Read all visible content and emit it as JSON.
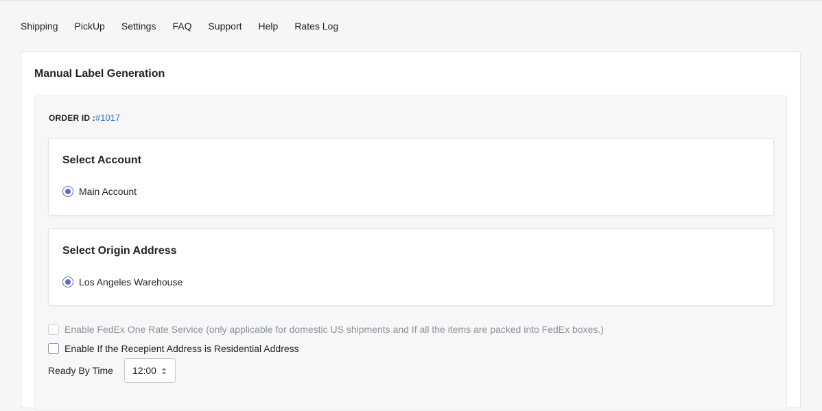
{
  "nav": {
    "items": [
      "Shipping",
      "PickUp",
      "Settings",
      "FAQ",
      "Support",
      "Help",
      "Rates Log"
    ]
  },
  "card": {
    "title": "Manual Label Generation",
    "order_label": "ORDER ID :",
    "order_value": "#1017"
  },
  "select_account": {
    "title": "Select Account",
    "option": "Main Account",
    "selected": true
  },
  "select_origin": {
    "title": "Select Origin Address",
    "option": "Los Angeles Warehouse",
    "selected": true
  },
  "options": {
    "one_rate_label": "Enable FedEx One Rate Service (only applicable for domestic US shipments and If all the items are packed into FedEx boxes.)",
    "one_rate_checked": false,
    "one_rate_disabled": true,
    "residential_label": "Enable If the Recepient Address is Residential Address",
    "residential_checked": false
  },
  "ready_by": {
    "label": "Ready By Time",
    "value": "12:00"
  },
  "colors": {
    "accent": "#5c6ac4",
    "link": "#2c6ecb"
  }
}
